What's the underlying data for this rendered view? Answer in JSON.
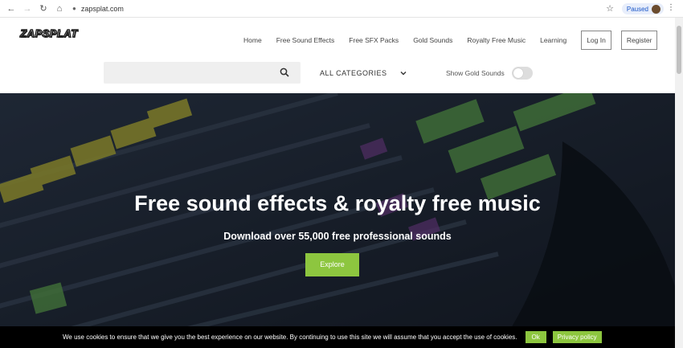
{
  "browser": {
    "url": "zapsplat.com",
    "profile_label": "Paused",
    "icons": [
      "back-icon",
      "forward-icon",
      "reload-icon",
      "home-icon",
      "lock-icon",
      "star-icon",
      "menu-icon"
    ]
  },
  "header": {
    "logo_text": "ZAPSPLAT",
    "nav": {
      "home": "Home",
      "free_sound_effects": "Free Sound Effects",
      "free_sfx_packs": "Free SFX Packs",
      "gold_sounds": "Gold Sounds",
      "royalty_free_music": "Royalty Free Music",
      "learning": "Learning",
      "login": "Log In",
      "register": "Register"
    },
    "search": {
      "placeholder": "",
      "value": ""
    },
    "categories_label": "ALL CATEGORIES",
    "gold_toggle_label": "Show Gold Sounds",
    "gold_toggle_on": false
  },
  "hero": {
    "title": "Free sound effects & royalty free music",
    "subtitle": "Download over 55,000 free professional sounds",
    "button_label": "Explore"
  },
  "cookie": {
    "text": "We use cookies to ensure that we give you the best experience on our website. By continuing to use this site we will assume that you accept the use of cookies.",
    "ok_label": "Ok",
    "policy_label": "Privacy policy"
  },
  "colors": {
    "accent": "#8dc63f",
    "cookie_bg": "#000000"
  }
}
